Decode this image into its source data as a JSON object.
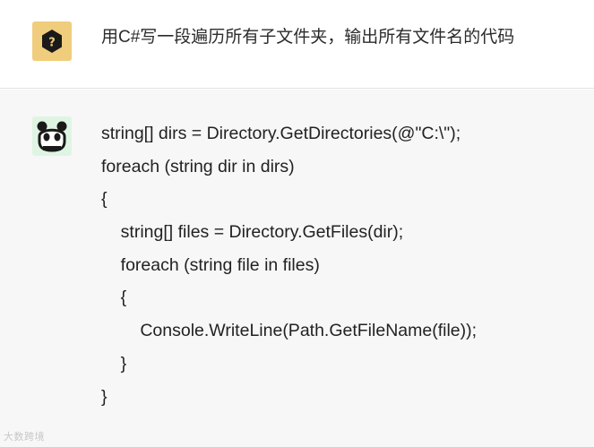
{
  "user": {
    "avatar_icon": "question-hexagon-icon",
    "message": "用C#写一段遍历所有子文件夹，输出所有文件名的代码"
  },
  "bot": {
    "avatar_icon": "panda-face-icon",
    "code_lines": [
      "string[] dirs = Directory.GetDirectories(@\"C:\\\");",
      "foreach (string dir in dirs)",
      "{",
      "    string[] files = Directory.GetFiles(dir);",
      "    foreach (string file in files)",
      "    {",
      "        Console.WriteLine(Path.GetFileName(file));",
      "    }",
      "}"
    ]
  },
  "watermark": {
    "text": "大数跨境"
  },
  "colors": {
    "user_avatar_bg": "#f0cd7c",
    "bot_avatar_bg": "#dff5e4",
    "bot_message_bg": "#f7f7f7"
  }
}
